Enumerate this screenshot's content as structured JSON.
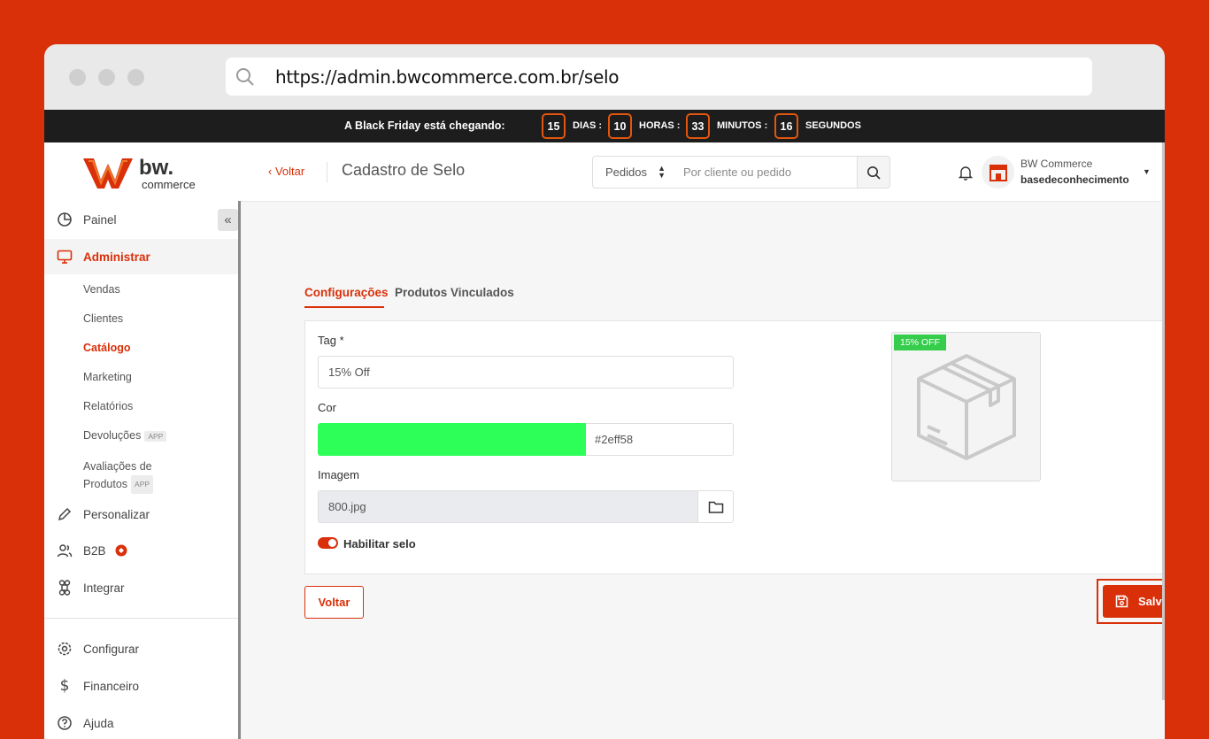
{
  "browser": {
    "url": "https://admin.bwcommerce.com.br/selo"
  },
  "promo": {
    "title": "A Black Friday está chegando:",
    "days": "15",
    "days_label": "DIAS :",
    "hours": "10",
    "hours_label": "HORAS :",
    "minutes": "33",
    "minutes_label": "MINUTOS :",
    "seconds": "16",
    "seconds_label": "SEGUNDOS"
  },
  "logo": {
    "brand": "bw.",
    "sub": "commerce"
  },
  "sidebar": {
    "items": [
      {
        "label": "Painel"
      },
      {
        "label": "Administrar"
      },
      {
        "label": "Personalizar"
      },
      {
        "label": "B2B"
      },
      {
        "label": "Integrar"
      },
      {
        "label": "Configurar"
      },
      {
        "label": "Financeiro"
      },
      {
        "label": "Ajuda"
      }
    ],
    "subitems": [
      {
        "label": "Vendas"
      },
      {
        "label": "Clientes"
      },
      {
        "label": "Catálogo"
      },
      {
        "label": "Marketing"
      },
      {
        "label": "Relatórios"
      },
      {
        "label": "Devoluções",
        "badge": "APP"
      },
      {
        "label": "Avaliações de",
        "label2": "Produtos",
        "badge": "APP"
      }
    ]
  },
  "header": {
    "back_label": "Voltar",
    "title": "Cadastro de Selo",
    "search_select": "Pedidos",
    "search_placeholder": "Por cliente ou pedido",
    "user_name": "BW Commerce",
    "user_store": "basedeconhecimento"
  },
  "tabs": [
    {
      "label": "Configurações"
    },
    {
      "label": "Produtos Vinculados"
    }
  ],
  "form": {
    "tag_label": "Tag *",
    "tag_value": "15% Off",
    "color_label": "Cor",
    "color_value": "#2eff58",
    "image_label": "Imagem",
    "image_value": "800.jpg",
    "toggle_label": "Habilitar selo",
    "toggle_on": true
  },
  "preview": {
    "tag_text": "15% OFF"
  },
  "actions": {
    "back_label": "Voltar",
    "save_label": "Salvar"
  },
  "colors": {
    "accent": "#d9300a",
    "seal": "#2eff58",
    "preview_tag": "#35cd4b"
  }
}
